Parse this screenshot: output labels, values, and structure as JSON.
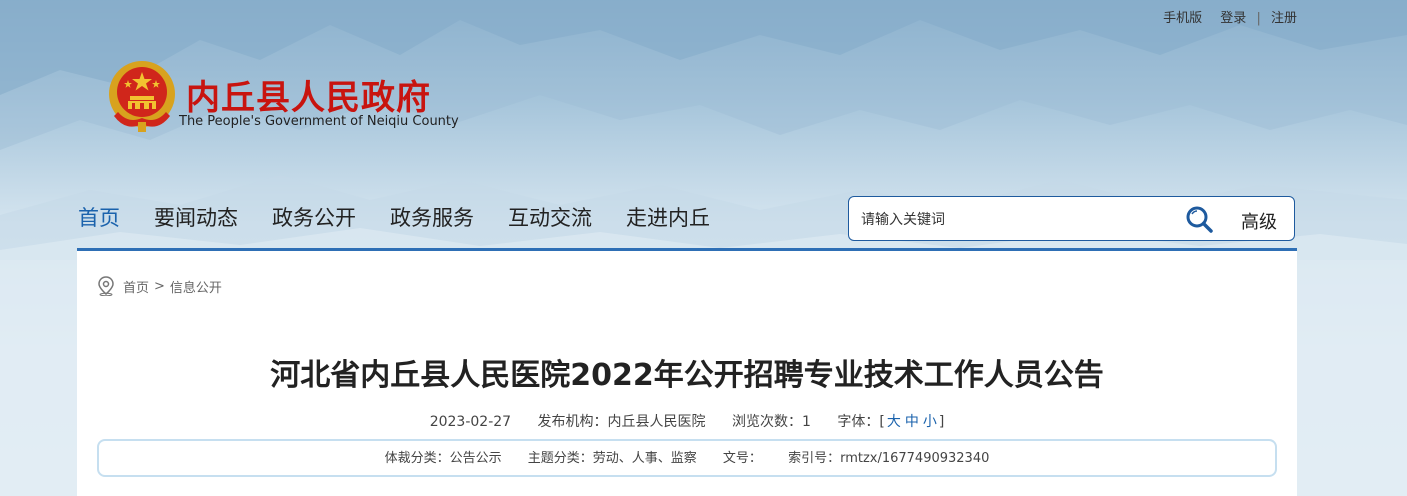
{
  "topbar": {
    "mobile": "手机版",
    "login": "登录",
    "sep": "|",
    "register": "注册"
  },
  "site": {
    "title": "内丘县人民政府",
    "subtitle": "The People's Government of Neiqiu County"
  },
  "nav": [
    {
      "label": "首页",
      "active": true
    },
    {
      "label": "要闻动态"
    },
    {
      "label": "政务公开"
    },
    {
      "label": "政务服务"
    },
    {
      "label": "互动交流"
    },
    {
      "label": "走进内丘"
    }
  ],
  "search": {
    "placeholder": "请输入关键词",
    "value": "",
    "advanced": "高级"
  },
  "breadcrumb": {
    "home": "首页",
    "arrow": ">",
    "current": "信息公开"
  },
  "article": {
    "title": "河北省内丘县人民医院2022年公开招聘专业技术工作人员公告",
    "date": "2023-02-27",
    "publisher": "发布机构：内丘县人民医院",
    "views": "浏览次数：1",
    "font_label": "字体：[",
    "font_large": "大",
    "font_medium": "中",
    "font_small": "小",
    "font_close": "]"
  },
  "info": {
    "genre": "体裁分类：公告公示",
    "topic": "主题分类：劳动、人事、监察",
    "doc_no": "文号：",
    "index_no": "索引号：rmtzx/1677490932340"
  },
  "colors": {
    "accent": "#1a62ac",
    "brand_red": "#c8140f",
    "border": "#1e5a9e"
  }
}
